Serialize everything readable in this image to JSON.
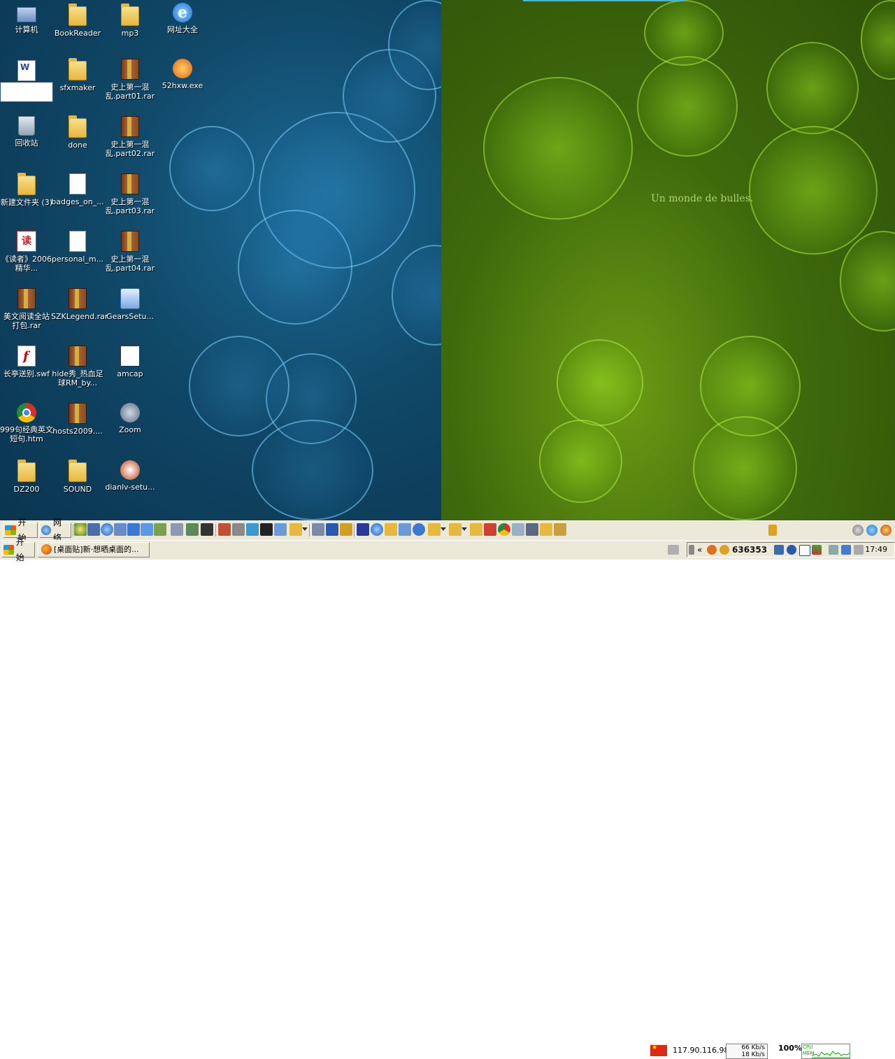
{
  "desktop": {
    "wallpaper_tagline": "Un monde de bulles.",
    "icons": [
      {
        "label": "计算机",
        "icon": "computer-icon"
      },
      {
        "label": "BookReader",
        "icon": "folder-icon"
      },
      {
        "label": "mp3",
        "icon": "folder-icon"
      },
      {
        "label": "网址大全",
        "icon": "ie-icon"
      },
      {
        "label": "",
        "icon": "word-doc-icon"
      },
      {
        "label": "sfxmaker",
        "icon": "folder-icon"
      },
      {
        "label": "史上第一混乱.part01.rar",
        "icon": "rar-icon"
      },
      {
        "label": "52hxw.exe",
        "icon": "exe-icon"
      },
      {
        "label": "回收站",
        "icon": "recycle-bin-icon"
      },
      {
        "label": "done",
        "icon": "folder-icon"
      },
      {
        "label": "史上第一混乱.part02.rar",
        "icon": "rar-icon"
      },
      {
        "label": "新建文件夹 (3)",
        "icon": "folder-icon"
      },
      {
        "label": "badges_on_...",
        "icon": "file-icon"
      },
      {
        "label": "史上第一混乱.part03.rar",
        "icon": "rar-icon"
      },
      {
        "label": "《读者》2006精华...",
        "icon": "reader-icon"
      },
      {
        "label": "personal_m...",
        "icon": "file-icon"
      },
      {
        "label": "史上第一混乱.part04.rar",
        "icon": "rar-icon"
      },
      {
        "label": "美文阅读全站打包.rar",
        "icon": "rar-icon"
      },
      {
        "label": "SZKLegend.rar",
        "icon": "rar-icon"
      },
      {
        "label": "GearsSetu...",
        "icon": "installer-icon"
      },
      {
        "label": "长亭送别.swf",
        "icon": "swf-icon"
      },
      {
        "label": "hide秀_热血足球RM_by...",
        "icon": "rar-icon"
      },
      {
        "label": "amcap",
        "icon": "amcap-icon"
      },
      {
        "label": "999句经典英文短句.htm",
        "icon": "chrome-icon"
      },
      {
        "label": "hosts2009....",
        "icon": "rar-icon"
      },
      {
        "label": "Zoom",
        "icon": "zoom-icon"
      },
      {
        "label": "DZ200",
        "icon": "folder-icon"
      },
      {
        "label": "SOUND",
        "icon": "folder-icon"
      },
      {
        "label": "dianlv-setu...",
        "icon": "dianlv-icon"
      }
    ]
  },
  "quicklaunch": {
    "start_label": "开始",
    "network_label": "网络",
    "ip_address": "117.90.116.98",
    "net_down": "66 Kb/s",
    "net_up": "18 Kb/s",
    "percent": "100%",
    "cpu_label": "CPU",
    "mem_label": "MEM"
  },
  "taskbar": {
    "start_label": "开始",
    "task_title": "[桌面贴]新·想晒桌面的...",
    "tray_numbers": "636353",
    "clock": "17:49"
  },
  "colors": {
    "wallpaper_blue": "#104868",
    "wallpaper_green": "#3f6a0c",
    "taskbar_bg": "#ece9d8"
  }
}
